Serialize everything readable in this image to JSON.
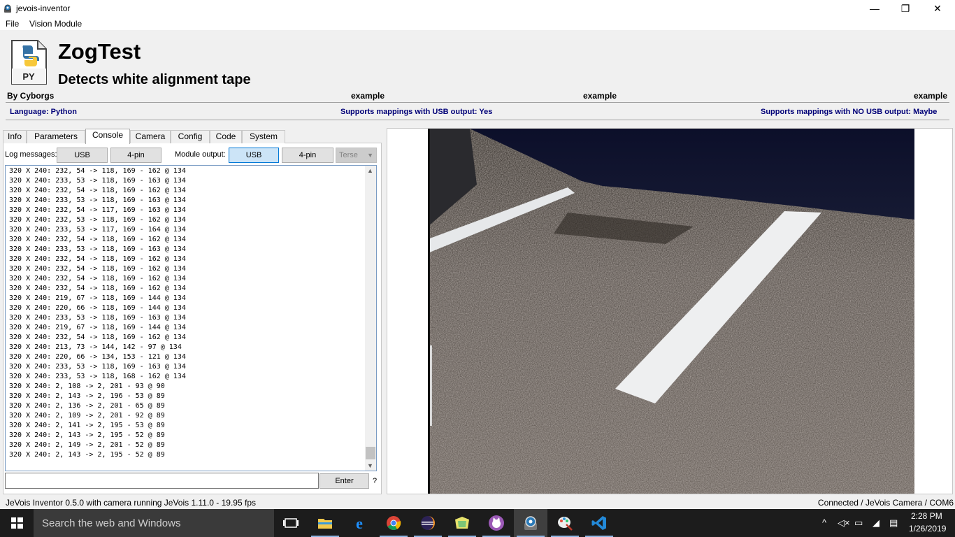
{
  "window": {
    "title": "jevois-inventor",
    "minimize_glyph": "—",
    "maximize_glyph": "❐",
    "close_glyph": "✕"
  },
  "menu": {
    "items": [
      "File",
      "Vision Module"
    ]
  },
  "module": {
    "icon_label": "PY",
    "title": "ZogTest",
    "description": "Detects white alignment tape",
    "author": "By Cyborgs",
    "examples": [
      "example",
      "example",
      "example"
    ],
    "language": "Language: Python",
    "usb_support": "Supports mappings with USB output: Yes",
    "nousb_support": "Supports mappings with NO USB output: Maybe"
  },
  "tabs": [
    "Info",
    "Parameters",
    "Console",
    "Camera",
    "Config",
    "Code",
    "System"
  ],
  "active_tab": "Console",
  "console": {
    "log_label": "Log messages:",
    "log_buttons": [
      "USB",
      "4-pin"
    ],
    "module_label": "Module output:",
    "module_buttons": [
      "USB",
      "4-pin"
    ],
    "verbosity": "Terse",
    "lines": [
      "320 X 240: 232, 54 -> 118, 169 - 162 @ 134",
      "320 X 240: 233, 53 -> 118, 169 - 163 @ 134",
      "320 X 240: 232, 54 -> 118, 169 - 162 @ 134",
      "320 X 240: 233, 53 -> 118, 169 - 163 @ 134",
      "320 X 240: 232, 54 -> 117, 169 - 163 @ 134",
      "320 X 240: 232, 53 -> 118, 169 - 162 @ 134",
      "320 X 240: 233, 53 -> 117, 169 - 164 @ 134",
      "320 X 240: 232, 54 -> 118, 169 - 162 @ 134",
      "320 X 240: 233, 53 -> 118, 169 - 163 @ 134",
      "320 X 240: 232, 54 -> 118, 169 - 162 @ 134",
      "320 X 240: 232, 54 -> 118, 169 - 162 @ 134",
      "320 X 240: 232, 54 -> 118, 169 - 162 @ 134",
      "320 X 240: 232, 54 -> 118, 169 - 162 @ 134",
      "320 X 240: 219, 67 -> 118, 169 - 144 @ 134",
      "320 X 240: 220, 66 -> 118, 169 - 144 @ 134",
      "320 X 240: 233, 53 -> 118, 169 - 163 @ 134",
      "320 X 240: 219, 67 -> 118, 169 - 144 @ 134",
      "320 X 240: 232, 54 -> 118, 169 - 162 @ 134",
      "320 X 240: 213, 73 -> 144, 142 - 97 @ 134",
      "320 X 240: 220, 66 -> 134, 153 - 121 @ 134",
      "320 X 240: 233, 53 -> 118, 169 - 163 @ 134",
      "320 X 240: 233, 53 -> 118, 168 - 162 @ 134",
      "320 X 240: 2, 108 -> 2, 201 - 93 @ 90",
      "320 X 240: 2, 143 -> 2, 196 - 53 @ 89",
      "320 X 240: 2, 136 -> 2, 201 - 65 @ 89",
      "320 X 240: 2, 109 -> 2, 201 - 92 @ 89",
      "320 X 240: 2, 141 -> 2, 195 - 53 @ 89",
      "320 X 240: 2, 143 -> 2, 195 - 52 @ 89",
      "320 X 240: 2, 149 -> 2, 201 - 52 @ 89",
      "320 X 240: 2, 143 -> 2, 195 - 52 @ 89"
    ],
    "command_value": "",
    "enter_label": "Enter",
    "help_label": "?"
  },
  "status": {
    "left": "JeVois Inventor 0.5.0 with camera running JeVois 1.11.0 - 19.95 fps",
    "right": "Connected / JeVois Camera / COM6"
  },
  "taskbar": {
    "search_placeholder": "Search the web and Windows",
    "apps": [
      "task-view-icon",
      "file-explorer-icon",
      "edge-icon",
      "chrome-icon",
      "eclipse-icon",
      "folder-app-icon",
      "github-icon",
      "jevois-inventor-icon",
      "paint-icon",
      "vscode-icon"
    ],
    "time": "2:28 PM",
    "date": "1/26/2019"
  },
  "colors": {
    "accent_blue": "#000078",
    "active_button": "#cce4f7",
    "taskbar": "#1c1c1c"
  }
}
